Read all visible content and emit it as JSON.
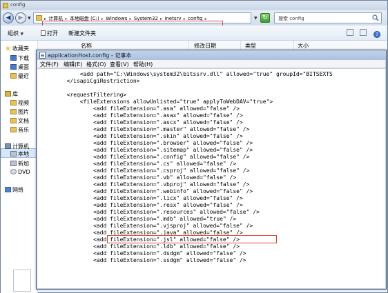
{
  "explorer": {
    "title": "config",
    "breadcrumbs": [
      "计算机",
      "本地磁盘 (C:)",
      "Windows",
      "System32",
      "inetsrv",
      "config"
    ],
    "search_placeholder": "搜索 config",
    "toolbar": {
      "organize": "组织",
      "open": "打开",
      "new_folder": "新建文件夹"
    },
    "nav": {
      "favorites": "收藏夹",
      "downloads": "下载",
      "desktop": "桌面",
      "recent": "最近",
      "libraries": "库",
      "videos": "视频",
      "pictures": "图片",
      "documents": "文档",
      "music": "音乐",
      "computer": "计算机",
      "local_disk": "本地",
      "new_volume": "新加",
      "dvd": "DVD",
      "network": "网络"
    },
    "columns": {
      "name": "名称",
      "date": "修改日期",
      "type": "类型",
      "size": "大小"
    }
  },
  "notepad": {
    "title": "applicationHost.config - 记事本",
    "menu": {
      "file": "文件(F)",
      "edit": "编辑(E)",
      "format": "格式(O)",
      "view": "查看(V)",
      "help": "帮助(H)"
    },
    "lines": [
      "            <add path=\"C:\\Windows\\system32\\bitssrv.dll\" allowed=\"true\" groupId=\"BITSEXTS",
      "        </isapiCgiRestriction>",
      "",
      "        <requestFiltering>",
      "            <fileExtensions allowUnlisted=\"true\" applyToWebDAV=\"true\">",
      "                <add fileExtension=\".asa\" allowed=\"false\" />",
      "                <add fileExtension=\".asax\" allowed=\"false\" />",
      "                <add fileExtension=\".ascx\" allowed=\"false\" />",
      "                <add fileExtension=\".master\" allowed=\"false\" />",
      "                <add fileExtension=\".skin\" allowed=\"false\" />",
      "                <add fileExtension=\".browser\" allowed=\"false\" />",
      "                <add fileExtension=\".sitemap\" allowed=\"false\" />",
      "                <add fileExtension=\".config\" allowed=\"false\" />",
      "                <add fileExtension=\".cs\" allowed=\"false\" />",
      "                <add fileExtension=\".csproj\" allowed=\"false\" />",
      "                <add fileExtension=\".vb\" allowed=\"false\" />",
      "                <add fileExtension=\".vbproj\" allowed=\"false\" />",
      "                <add fileExtension=\".webinfo\" allowed=\"false\" />",
      "                <add fileExtension=\".licx\" allowed=\"false\" />",
      "                <add fileExtension=\".resx\" allowed=\"false\" />",
      "                <add fileExtension=\".resources\" allowed=\"false\" />",
      "                <add fileExtension=\".mdb\" allowed=\"true\" />",
      "                <add fileExtension=\".vjsproj\" allowed=\"false\" />",
      "                <add fileExtension=\".java\" allowed=\"false\" />",
      "                <add fileExtension=\".jsl\" allowed=\"false\" />",
      "                <add fileExtension=\".ldb\" allowed=\"false\" />",
      "                <add fileExtension=\".dsdgm\" allowed=\"false\" />",
      "                <add fileExtension=\".ssdgm\" allowed=\"false\" />"
    ]
  },
  "colors": {
    "highlight_border": "#d9423a",
    "notepad_frame": "#bcd0e8",
    "explorer_bg": "#f4f7fb"
  }
}
